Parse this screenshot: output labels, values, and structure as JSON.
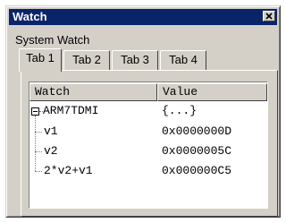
{
  "window": {
    "title": "Watch"
  },
  "group_label": "System Watch",
  "tabs": [
    {
      "label": "Tab 1",
      "active": true
    },
    {
      "label": "Tab 2",
      "active": false
    },
    {
      "label": "Tab 3",
      "active": false
    },
    {
      "label": "Tab 4",
      "active": false
    }
  ],
  "columns": {
    "watch": "Watch",
    "value": "Value"
  },
  "rows": [
    {
      "name": "ARM7TDMI",
      "value": "{...}"
    },
    {
      "name": "v1",
      "value": "0x0000000D"
    },
    {
      "name": "v2",
      "value": "0x0000005C"
    },
    {
      "name": "2*v2+v1",
      "value": "0x000000C5"
    }
  ],
  "icons": {
    "close": "close-icon",
    "expander": "collapse-minus-icon"
  },
  "colors": {
    "titlebar": "#0a246a",
    "face": "#d4d0c8"
  }
}
